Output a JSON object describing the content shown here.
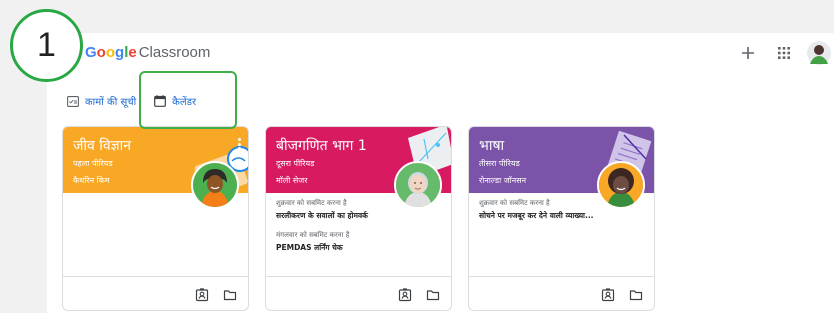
{
  "brand": {
    "logo_letters": [
      "G",
      "o",
      "o",
      "g",
      "l",
      "e"
    ],
    "logo_colors": [
      "#4285f4",
      "#ea4335",
      "#fbbc05",
      "#4285f4",
      "#34a853",
      "#ea4335"
    ],
    "product": "Classroom"
  },
  "header": {
    "add_icon": "plus-icon",
    "apps_icon": "apps-grid-icon",
    "account_icon": "account-avatar"
  },
  "tabs": [
    {
      "label": "कामों की सूची",
      "icon": "todo-checklist-icon"
    },
    {
      "label": "कैलेंडर",
      "icon": "calendar-icon"
    }
  ],
  "callout": {
    "number": "1",
    "color": "#28a745"
  },
  "cards": [
    {
      "title": "जीव विज्ञान",
      "section": "पहला पीरियड",
      "teacher": "कैथरिन किम",
      "color": "#f9a825",
      "assignments": []
    },
    {
      "title": "बीजगणित भाग 1",
      "section": "दूसरा पीरियड",
      "teacher": "मॉली सेजर",
      "color": "#d81b60",
      "assignments": [
        {
          "due": "शुक्रवार को सबमिट करना है",
          "title": "सरलीकरण के सवालों का होमवर्क"
        },
        {
          "due": "मंगलवार को सबमिट करना है",
          "title": "PEMDAS लर्निंग चेक"
        }
      ]
    },
    {
      "title": "भाषा",
      "section": "तीसरा पीरियड",
      "teacher": "रोनाल्डा जॉनसन",
      "color": "#7b53a8",
      "assignments": [
        {
          "due": "शुक्रवार को सबमिट करना है",
          "title": "सोचने पर मजबूर कर देने वाली व्याख्या..."
        }
      ]
    }
  ]
}
